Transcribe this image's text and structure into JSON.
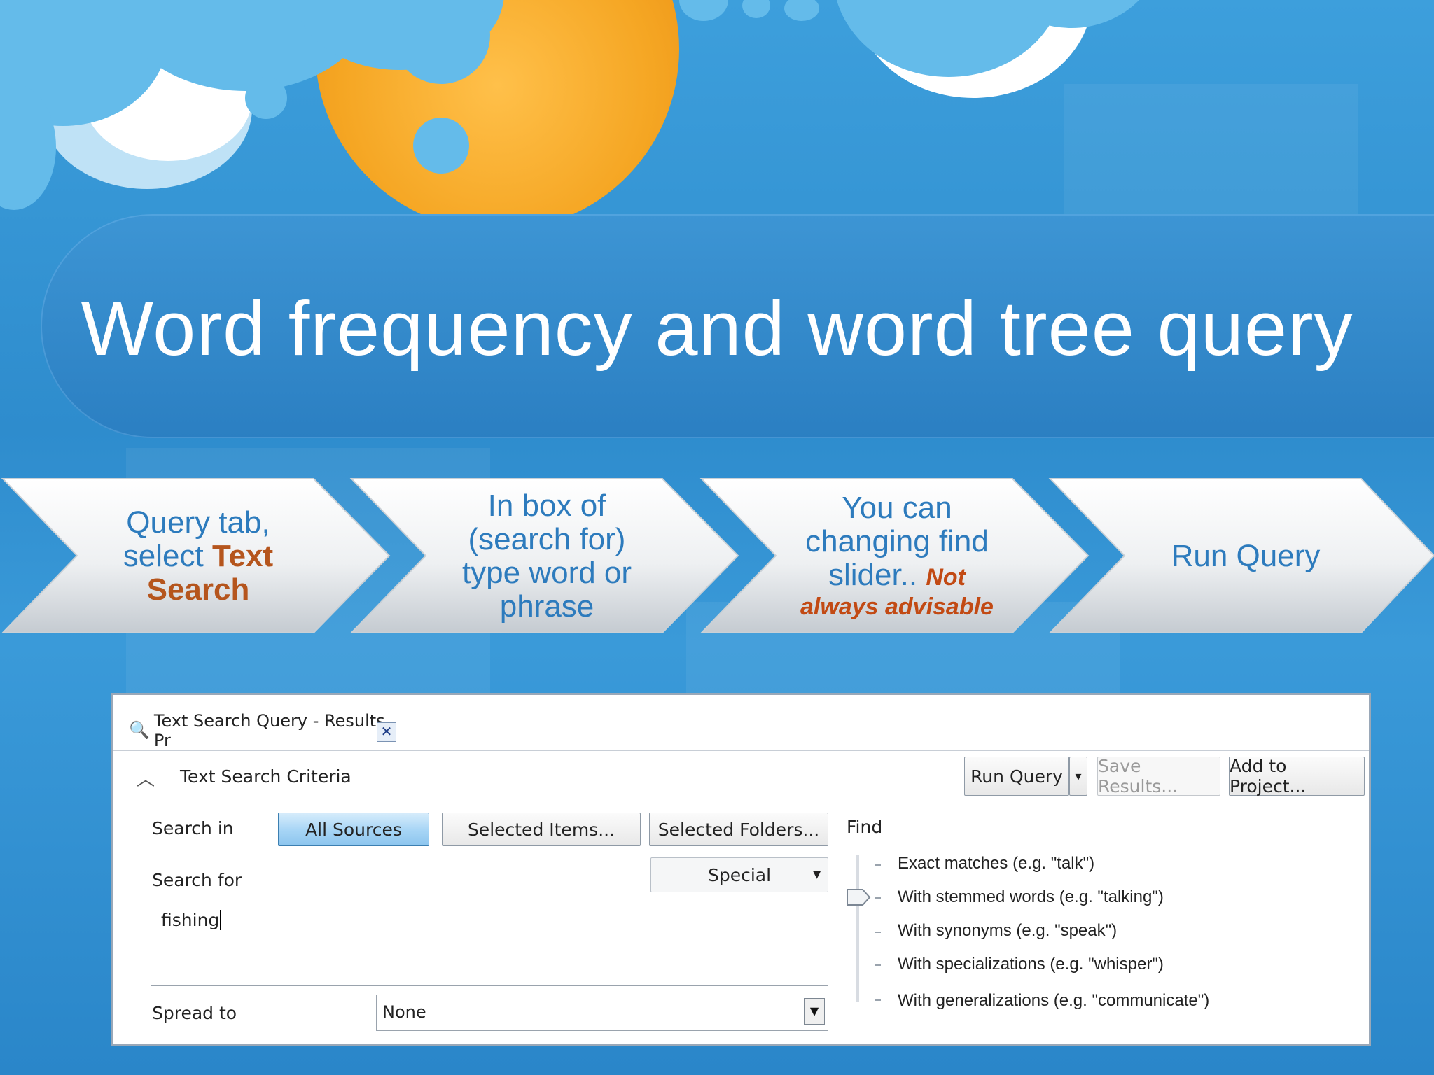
{
  "slide": {
    "title": "Word frequency and word tree query"
  },
  "steps": [
    {
      "line1": "Query tab,",
      "line2_plain": "select ",
      "line2_bold": "Text",
      "line3_bold": "Search"
    },
    {
      "line1": "In box of",
      "line2": "(search for)",
      "line3": "type word or",
      "line4": "phrase"
    },
    {
      "line1": "You can",
      "line2": "changing find",
      "line3_plain": "slider.. ",
      "line3_warn": "Not",
      "line4_warn": "always advisable"
    },
    {
      "line1": "Run Query"
    }
  ],
  "app": {
    "tab_title": "Text Search Query - Results Pr",
    "section_title": "Text Search Criteria",
    "toolbar": {
      "run_query": "Run Query",
      "run_query_arrow": "▾",
      "save_results": "Save Results...",
      "add_to_project": "Add to Project..."
    },
    "search_in_label": "Search in",
    "search_in_buttons": [
      "All Sources",
      "Selected Items...",
      "Selected Folders..."
    ],
    "search_for_label": "Search for",
    "search_for_value": "fishing",
    "special_button": "Special",
    "spread_to_label": "Spread to",
    "spread_to_value": "None",
    "find_label": "Find",
    "find_options": [
      "Exact matches (e.g. \"talk\")",
      "With stemmed words (e.g. \"talking\")",
      "With synonyms (e.g. \"speak\")",
      "With specializations (e.g. \"whisper\")",
      "With generalizations (e.g. \"communicate\")"
    ],
    "find_selected_index": 1
  },
  "colors": {
    "background": "#2f8fd0",
    "chevron_text": "#2d7bbd",
    "highlight": "#b5551d",
    "sun": "#f5a623"
  }
}
